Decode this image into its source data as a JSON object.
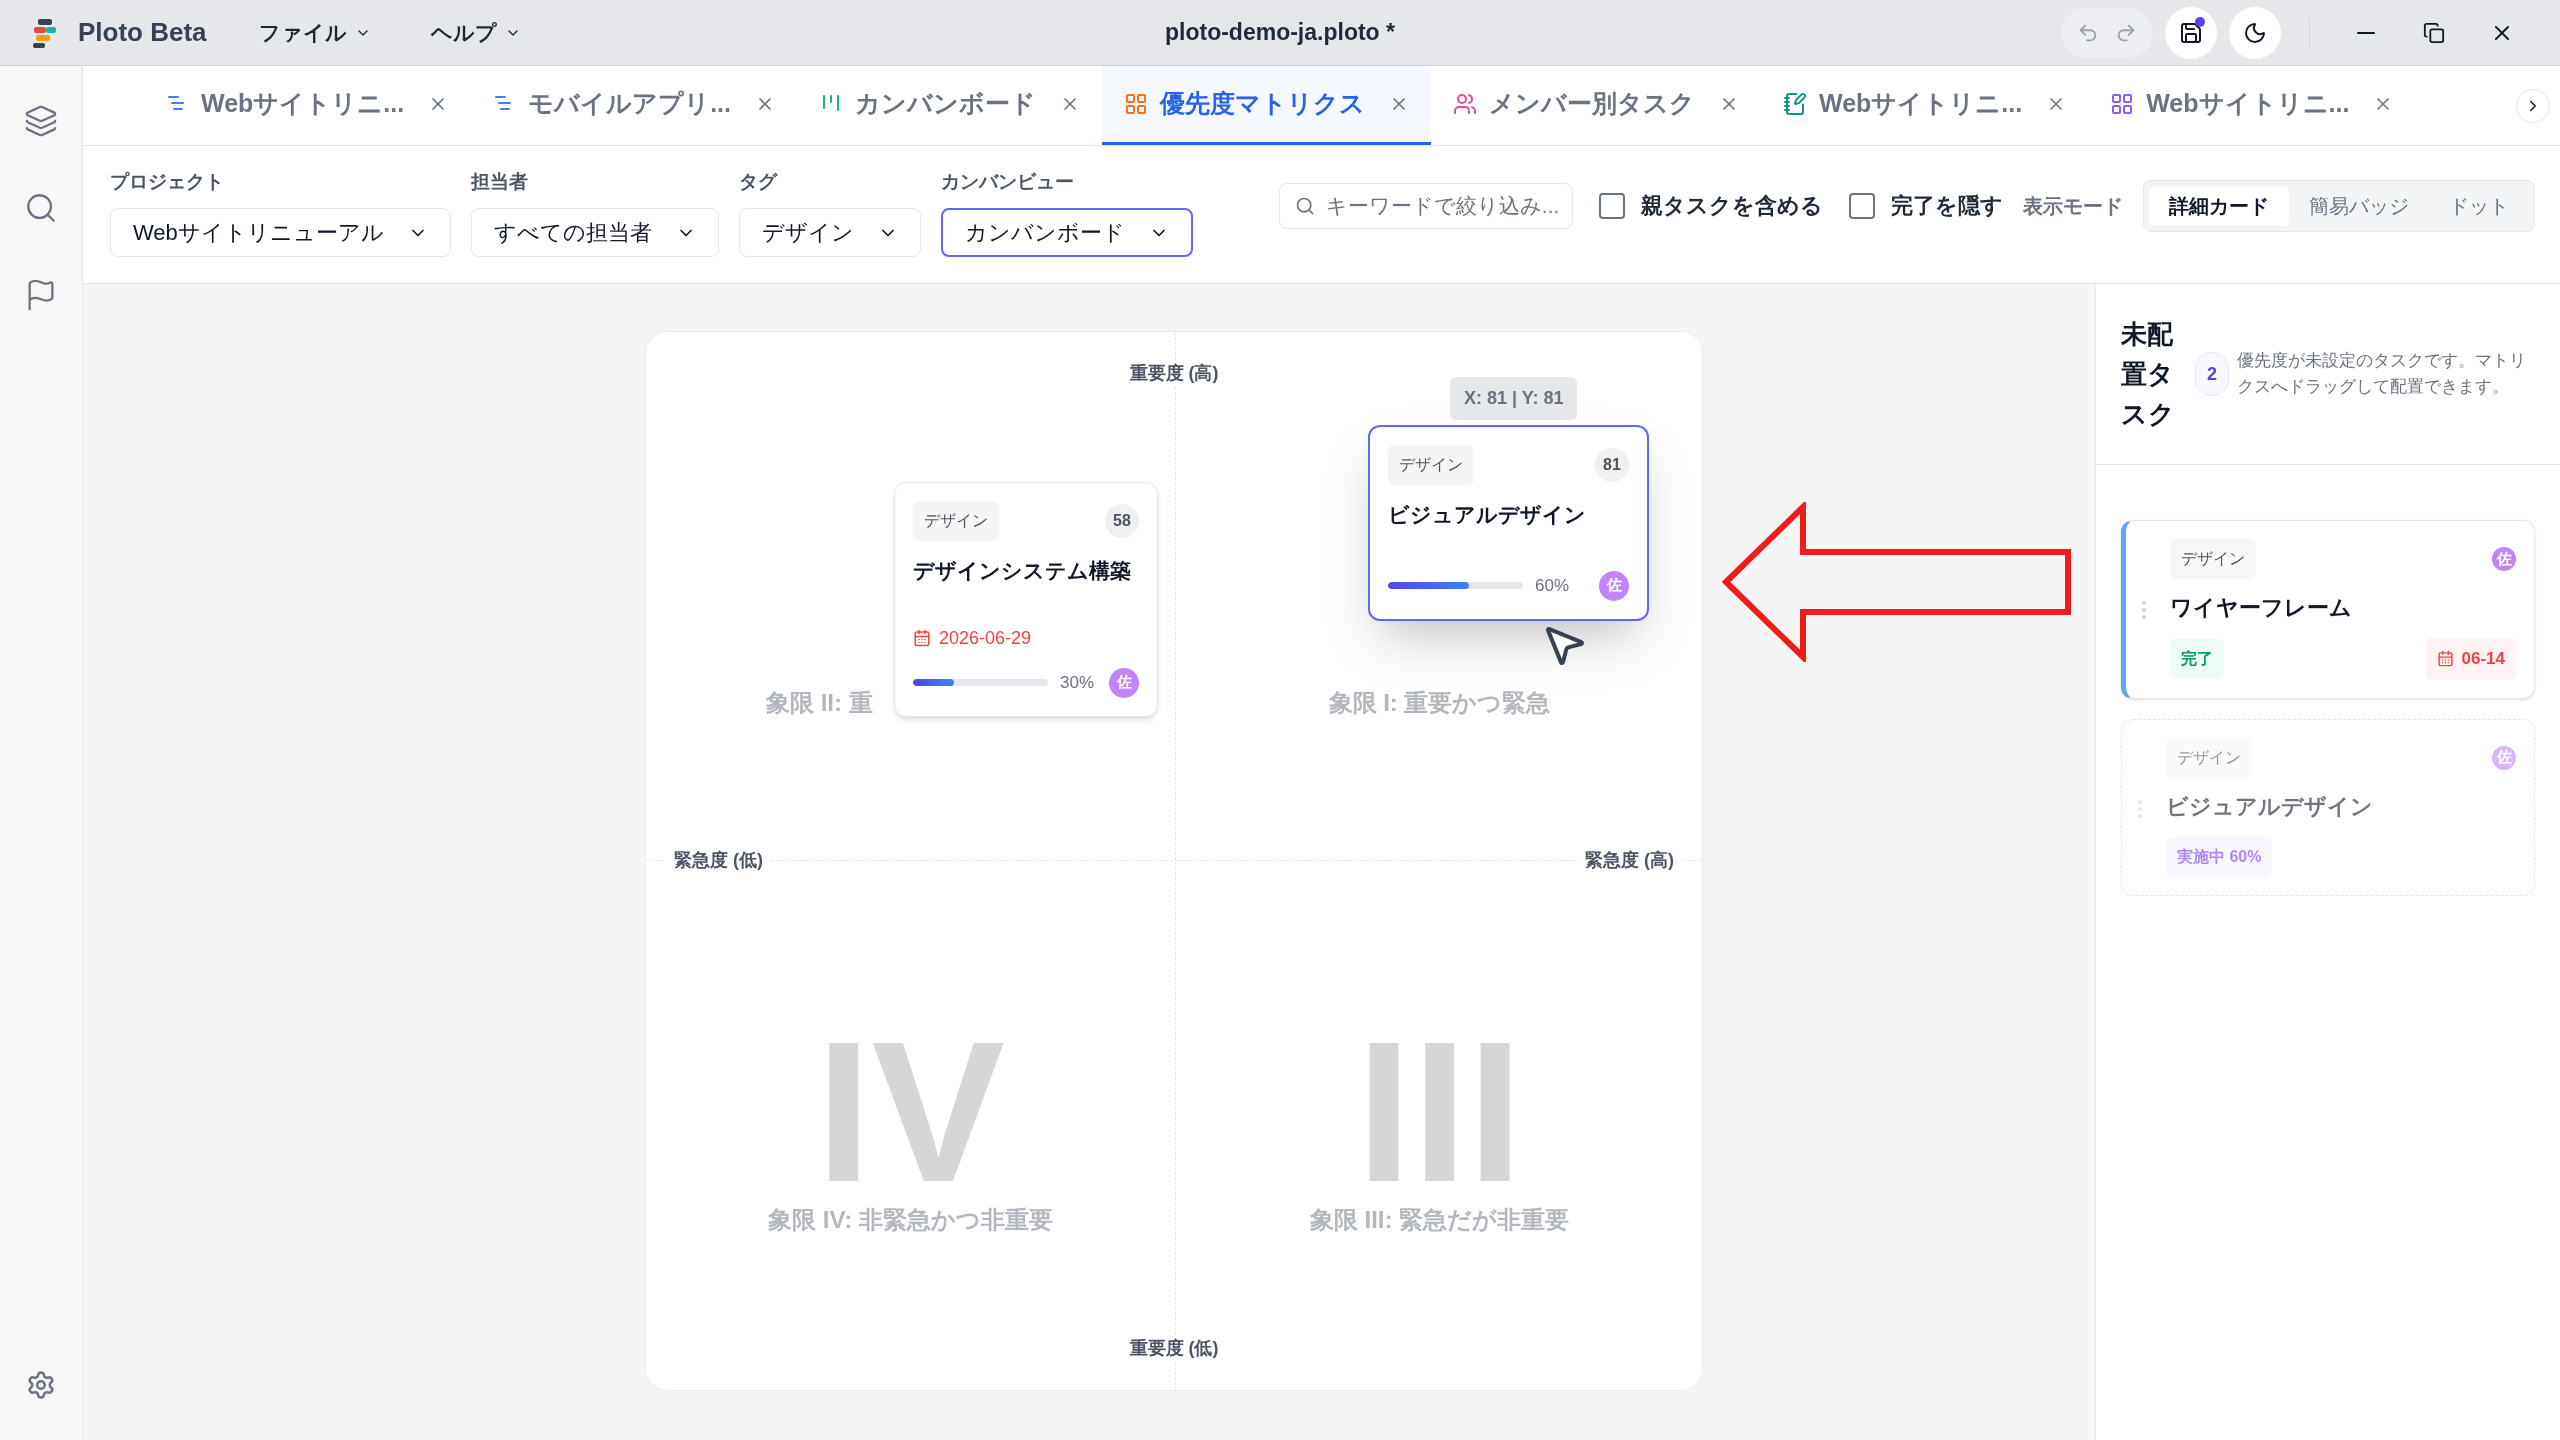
{
  "app": {
    "name": "Ploto Beta",
    "menus": [
      "ファイル",
      "ヘルプ"
    ],
    "title": "ploto-demo-ja.ploto *",
    "unsaved": true
  },
  "tabs": [
    {
      "label": "Webサイトリニ...",
      "kind": "list",
      "color": "#3b82f6",
      "selected": false
    },
    {
      "label": "モバイルアプリ...",
      "kind": "list",
      "color": "#3b82f6",
      "selected": false
    },
    {
      "label": "カンバンボード",
      "kind": "kanban",
      "color": "#10b981",
      "selected": false
    },
    {
      "label": "優先度マトリクス",
      "kind": "grid",
      "color": "#f97316",
      "selected": true
    },
    {
      "label": "メンバー別タスク",
      "kind": "people",
      "color": "#ec4899",
      "selected": false
    },
    {
      "label": "Webサイトリニ...",
      "kind": "notebook",
      "color": "#0d9488",
      "selected": false
    },
    {
      "label": "Webサイトリニ...",
      "kind": "grid",
      "color": "#8b5cf6",
      "selected": false
    }
  ],
  "filters": [
    {
      "label": "プロジェクト",
      "value": "Webサイトリニューアル",
      "focused": false
    },
    {
      "label": "担当者",
      "value": "すべての担当者",
      "focused": false
    },
    {
      "label": "タグ",
      "value": "デザイン",
      "focused": false
    },
    {
      "label": "カンバンビュー",
      "value": "カンバンボード",
      "focused": true
    }
  ],
  "search": {
    "placeholder": "キーワードで絞り込み..."
  },
  "checkboxes": [
    {
      "label": "親タスクを含める",
      "checked": false
    },
    {
      "label": "完了を隠す",
      "checked": false
    }
  ],
  "view_mode": {
    "label": "表示モード",
    "options": [
      {
        "label": "詳細カード",
        "selected": true
      },
      {
        "label": "簡易バッジ",
        "selected": false
      },
      {
        "label": "ドット",
        "selected": false
      }
    ]
  },
  "matrix": {
    "top": "重要度 (高)",
    "bottom": "重要度 (低)",
    "left": "緊急度 (低)",
    "right": "緊急度 (高)",
    "quadrants": [
      {
        "label": "象限 II: 重"
      },
      {
        "label": "象限 I: 重要かつ緊急"
      },
      {
        "numeral": "IV",
        "label": "象限 IV: 非緊急かつ非重要"
      },
      {
        "numeral": "III",
        "label": "象限 III: 緊急だが非重要"
      }
    ],
    "cards": [
      {
        "tag": "デザイン",
        "score": "58",
        "title": "デザインシステム構築",
        "due": "2026-06-29",
        "level": 0.3,
        "reading": "30%",
        "avatar": "佐",
        "dragging": false
      },
      {
        "tag": "デザイン",
        "score": "81",
        "title": "ビジュアルデザイン",
        "level": 0.6,
        "reading": "60%",
        "avatar": "佐",
        "dragging": true,
        "tooltip": "X: 81 | Y: 81"
      }
    ]
  },
  "unplaced": {
    "title": "未配置タスク",
    "count": "2",
    "description": "優先度が未設定のタスクです。マトリクスへドラッグして配置できます。",
    "cards": [
      {
        "tag": "デザイン",
        "avatar": "佐",
        "title": "ワイヤーフレーム",
        "status": "完了",
        "kind": "done",
        "due": "06-14",
        "ghost": false
      },
      {
        "tag": "デザイン",
        "avatar": "佐",
        "title": "ビジュアルデザイン",
        "status": "実施中 60%",
        "kind": "progress",
        "ghost": true
      }
    ]
  }
}
